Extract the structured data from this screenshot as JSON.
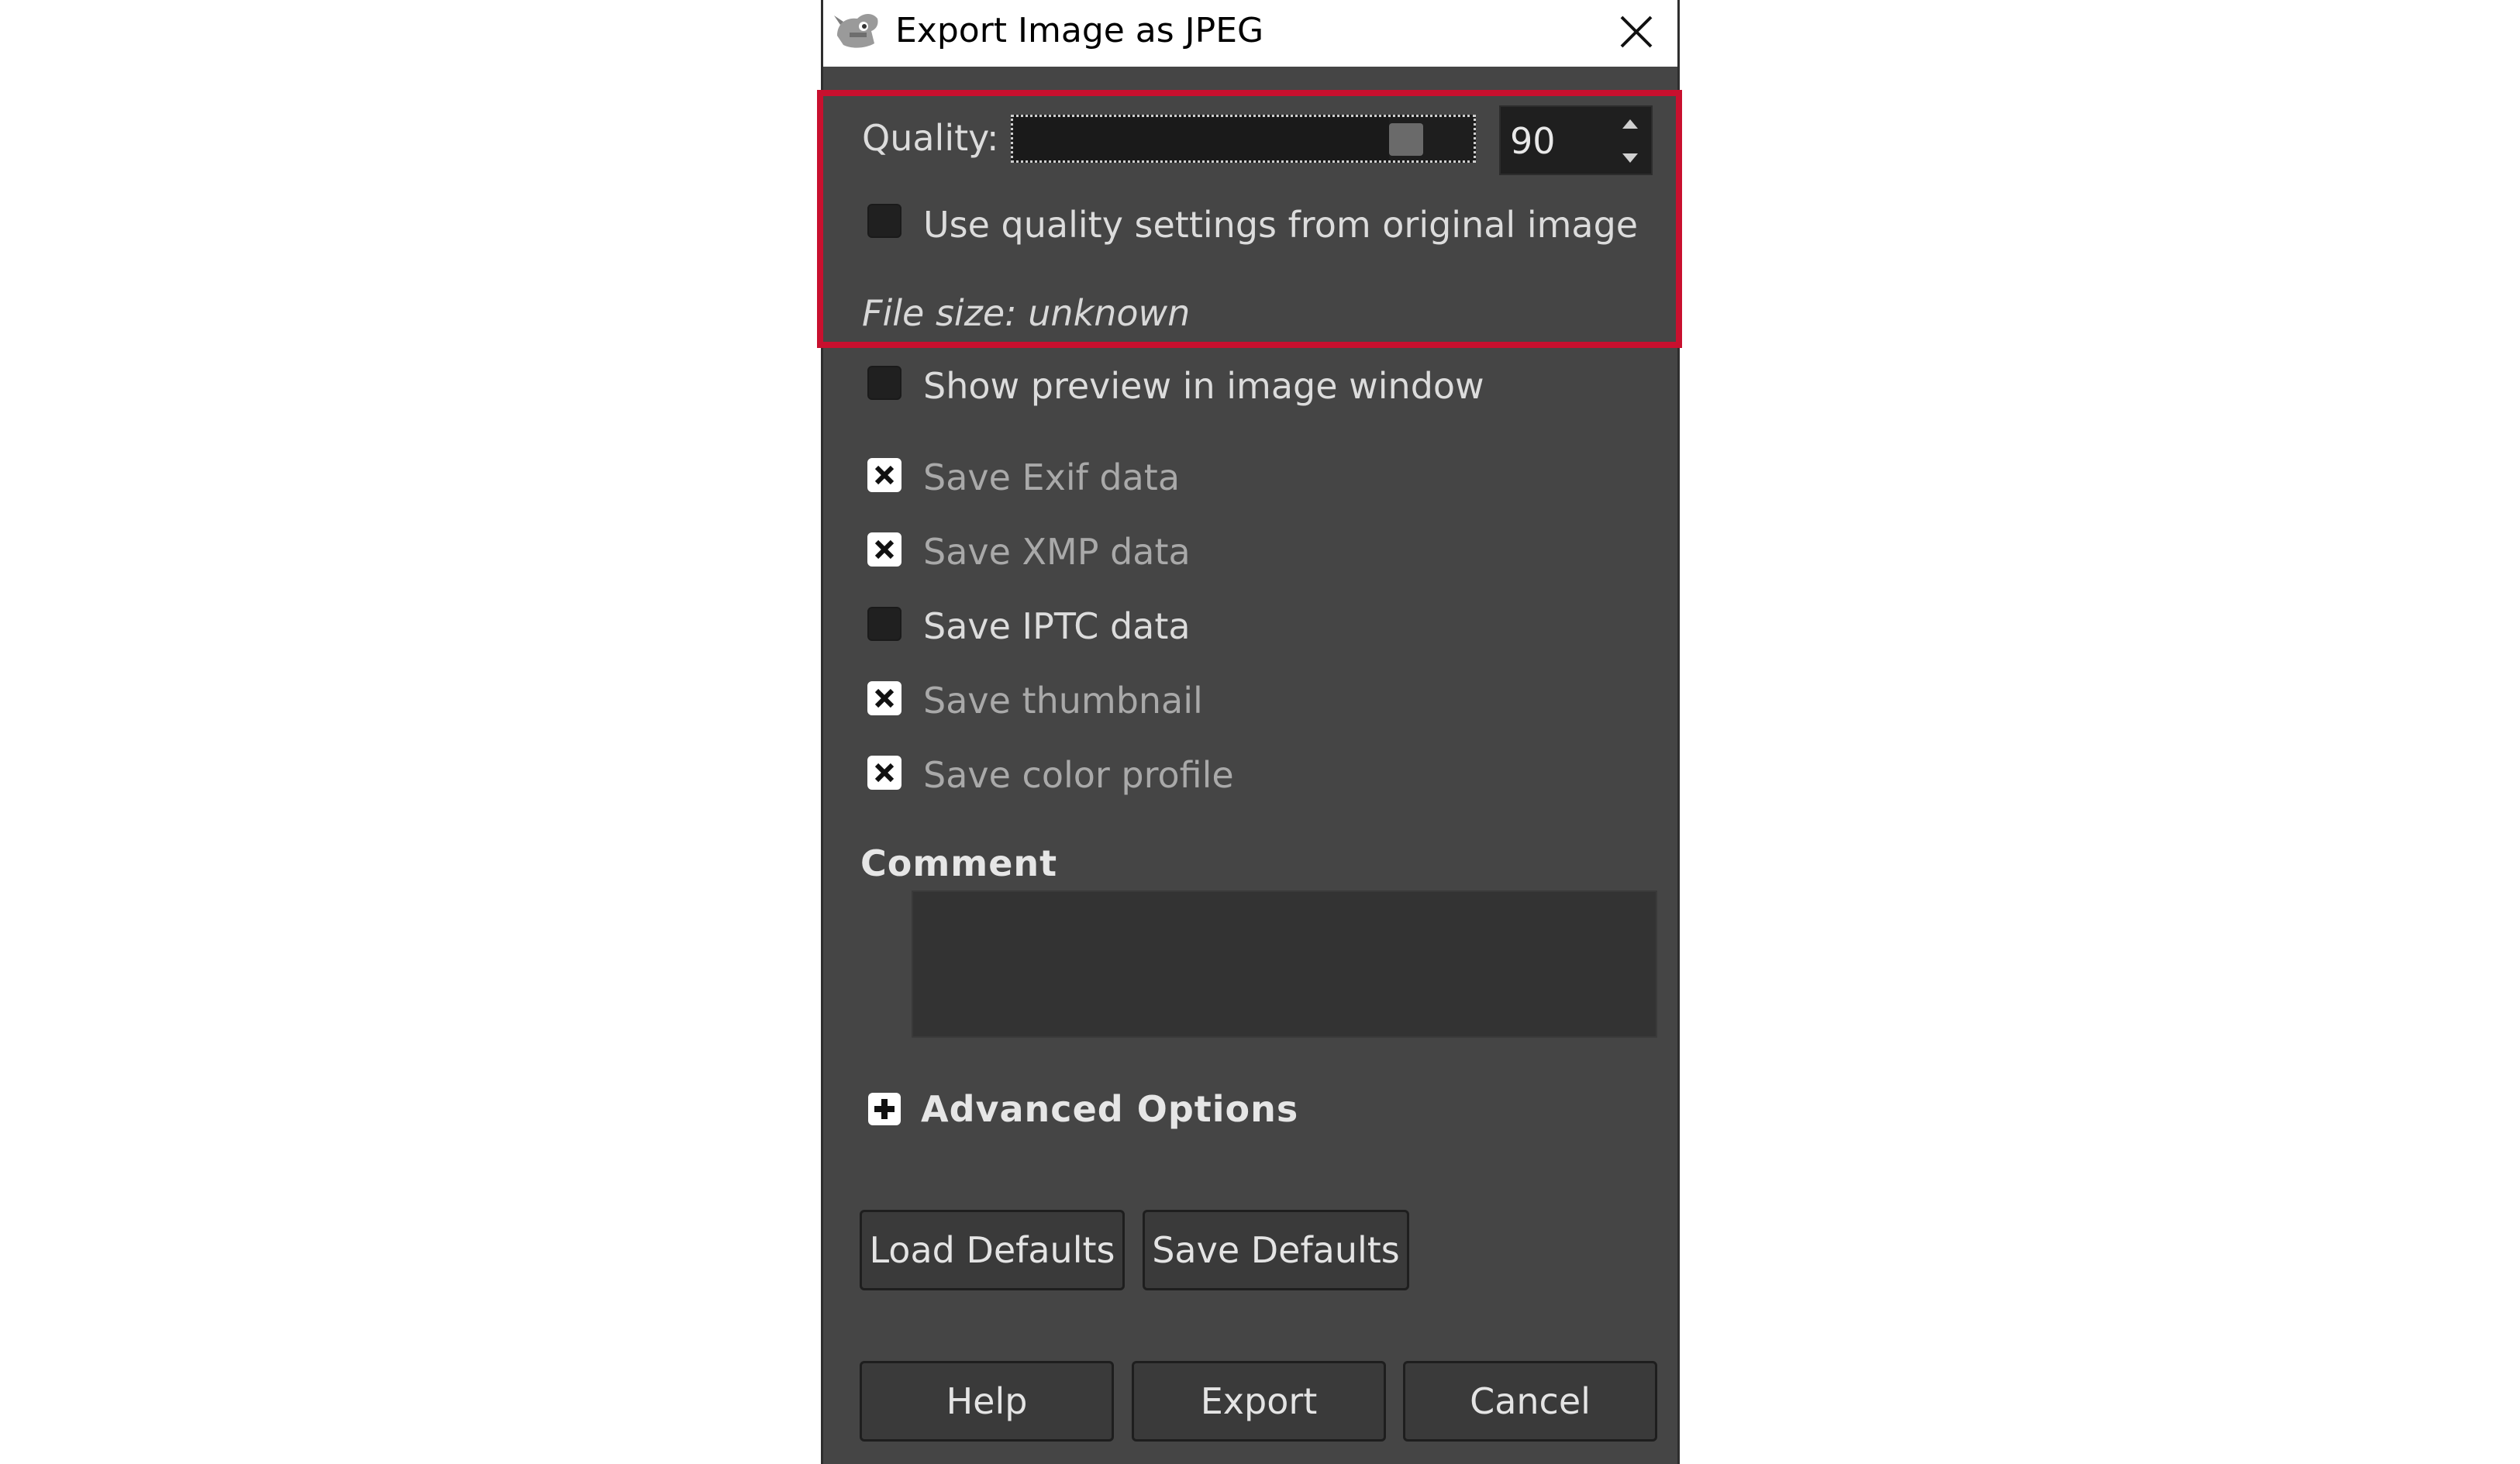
{
  "window": {
    "title": "Export Image as JPEG"
  },
  "icons": {
    "app": "gimp-wilber-icon",
    "close": "close-icon",
    "spin_up": "arrow-up-icon",
    "spin_down": "arrow-down-icon",
    "expand": "plus-icon"
  },
  "quality": {
    "label": "Quality:",
    "value": "90",
    "slider_fraction": 0.9
  },
  "options": {
    "use_original": {
      "label": "Use quality settings from original image",
      "checked": false
    },
    "file_size": "File size: unknown",
    "show_preview": {
      "label": "Show preview in image window",
      "checked": false
    },
    "save_exif": {
      "label": "Save Exif data",
      "checked": true
    },
    "save_xmp": {
      "label": "Save XMP data",
      "checked": true
    },
    "save_iptc": {
      "label": "Save IPTC data",
      "checked": false
    },
    "save_thumbnail": {
      "label": "Save thumbnail",
      "checked": true
    },
    "save_color_profile": {
      "label": "Save color profile",
      "checked": true
    }
  },
  "comment": {
    "label": "Comment",
    "value": ""
  },
  "advanced": {
    "label": "Advanced Options"
  },
  "buttons": {
    "load_defaults": "Load Defaults",
    "save_defaults": "Save Defaults",
    "help": "Help",
    "export": "Export",
    "cancel": "Cancel"
  },
  "colors": {
    "dialog_bg": "#454545",
    "highlight": "#c8102e"
  }
}
